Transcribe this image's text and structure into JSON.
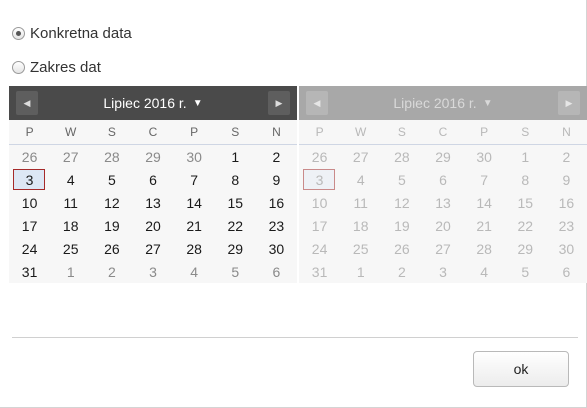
{
  "radio_options": [
    {
      "label": "Konkretna data",
      "checked": true
    },
    {
      "label": "Zakres dat",
      "checked": false
    }
  ],
  "calendars": [
    {
      "month_title": "Lipiec 2016 r.",
      "disabled": false,
      "weekdays": [
        "P",
        "W",
        "S",
        "C",
        "P",
        "S",
        "N"
      ],
      "weeks": [
        [
          "26",
          "27",
          "28",
          "29",
          "30",
          "1",
          "2"
        ],
        [
          "3",
          "4",
          "5",
          "6",
          "7",
          "8",
          "9"
        ],
        [
          "10",
          "11",
          "12",
          "13",
          "14",
          "15",
          "16"
        ],
        [
          "17",
          "18",
          "19",
          "20",
          "21",
          "22",
          "23"
        ],
        [
          "24",
          "25",
          "26",
          "27",
          "28",
          "29",
          "30"
        ],
        [
          "31",
          "1",
          "2",
          "3",
          "4",
          "5",
          "6"
        ]
      ],
      "today": "3"
    },
    {
      "month_title": "Lipiec 2016 r.",
      "disabled": true,
      "weekdays": [
        "P",
        "W",
        "S",
        "C",
        "P",
        "S",
        "N"
      ],
      "weeks": [
        [
          "26",
          "27",
          "28",
          "29",
          "30",
          "1",
          "2"
        ],
        [
          "3",
          "4",
          "5",
          "6",
          "7",
          "8",
          "9"
        ],
        [
          "10",
          "11",
          "12",
          "13",
          "14",
          "15",
          "16"
        ],
        [
          "17",
          "18",
          "19",
          "20",
          "21",
          "22",
          "23"
        ],
        [
          "24",
          "25",
          "26",
          "27",
          "28",
          "29",
          "30"
        ],
        [
          "31",
          "1",
          "2",
          "3",
          "4",
          "5",
          "6"
        ]
      ],
      "today": "3"
    }
  ],
  "icons": {
    "prev": "chevron-left-icon",
    "next": "chevron-right-icon",
    "caret": "caret-down-icon"
  },
  "ok_label": "ok"
}
